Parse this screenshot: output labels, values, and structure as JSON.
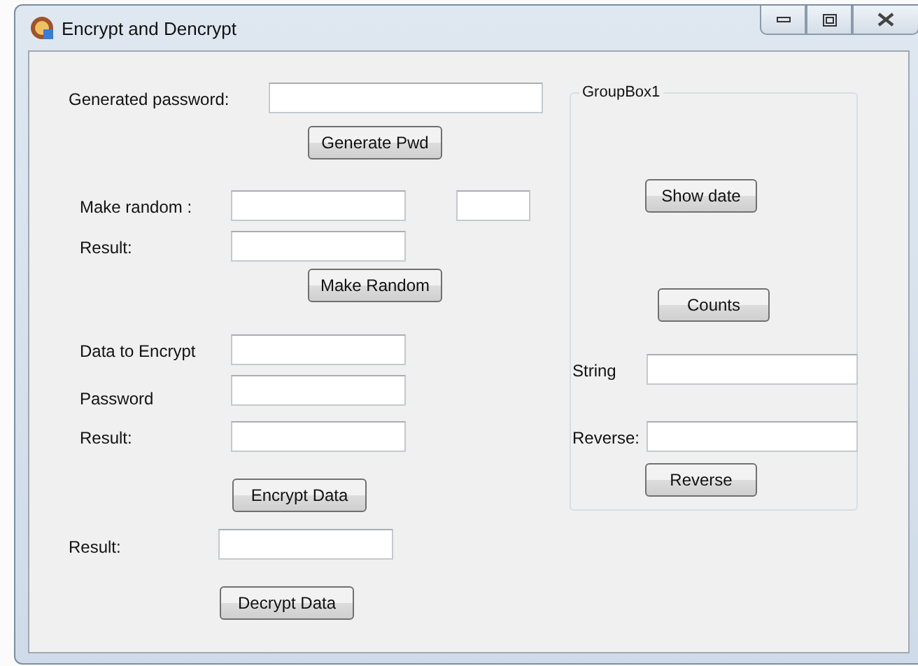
{
  "window": {
    "title": "Encrypt and Dencrypt"
  },
  "controls": [
    {
      "kind": "label",
      "text": "Generated password:"
    },
    {
      "kind": "input"
    },
    {
      "kind": "button",
      "text": "Generate Pwd"
    },
    {
      "kind": "label",
      "text": "Make random :"
    },
    {
      "kind": "input"
    },
    {
      "kind": "input"
    },
    {
      "kind": "label",
      "text": "Result:"
    },
    {
      "kind": "input"
    },
    {
      "kind": "button",
      "text": "Make Random"
    },
    {
      "kind": "label",
      "text": "Data to Encrypt"
    },
    {
      "kind": "input"
    },
    {
      "kind": "label",
      "text": "Password"
    },
    {
      "kind": "input"
    },
    {
      "kind": "label",
      "text": "Result:"
    },
    {
      "kind": "input"
    },
    {
      "kind": "button",
      "text": "Encrypt Data"
    },
    {
      "kind": "label",
      "text": "Result:"
    },
    {
      "kind": "input"
    },
    {
      "kind": "button",
      "text": "Decrypt Data"
    },
    {
      "kind": "groupbox",
      "text": "GroupBox1"
    },
    {
      "kind": "button",
      "text": "Show date"
    },
    {
      "kind": "button",
      "text": "Counts"
    },
    {
      "kind": "label",
      "text": "String"
    },
    {
      "kind": "input"
    },
    {
      "kind": "label",
      "text": "Reverse:"
    },
    {
      "kind": "input"
    },
    {
      "kind": "button",
      "text": "Reverse"
    }
  ]
}
